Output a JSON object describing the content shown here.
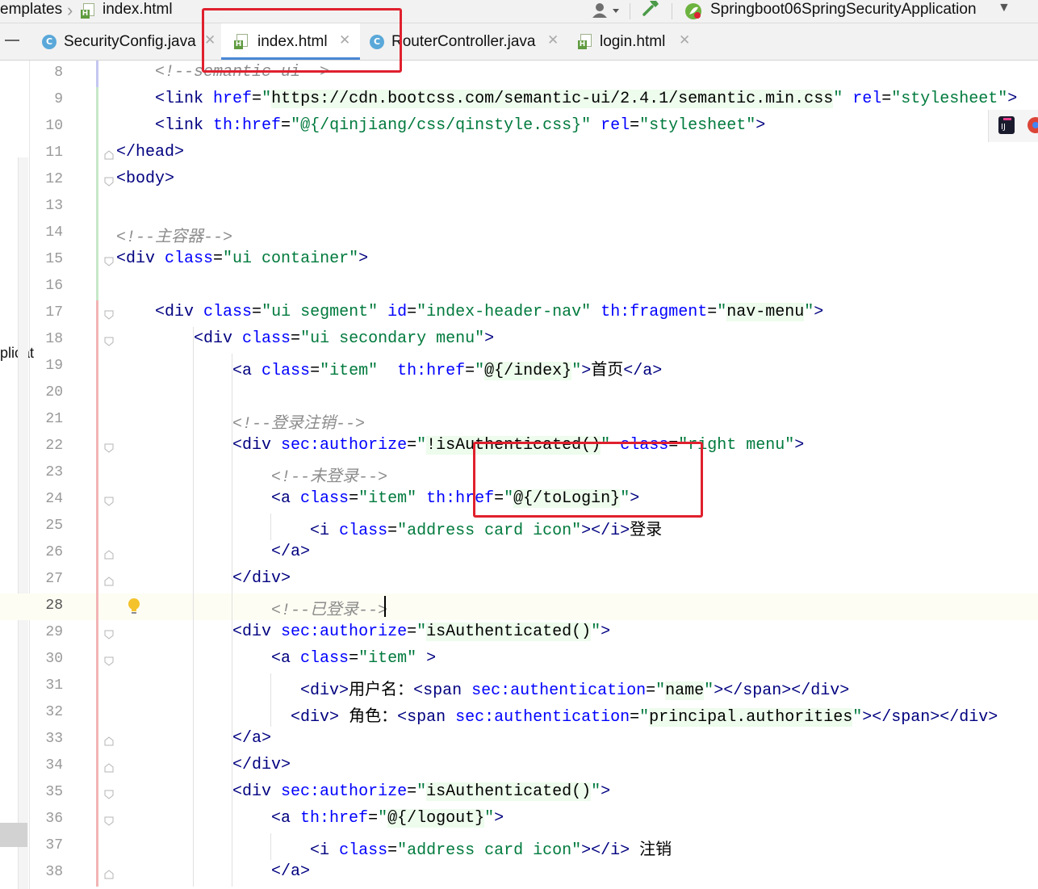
{
  "breadcrumb": {
    "folder": "emplates",
    "file": "index.html"
  },
  "run_config": {
    "name": "Springboot06SpringSecurityApplication"
  },
  "icons": [
    "user-icon",
    "hammer-icon",
    "spring-icon",
    "chevron-down-icon",
    "html-file-icon",
    "class-icon",
    "close-icon",
    "lightbulb-icon"
  ],
  "tabs": [
    {
      "label": "SecurityConfig.java",
      "type": "class",
      "active": false
    },
    {
      "label": "index.html",
      "type": "html",
      "active": true
    },
    {
      "label": "RouterController.java",
      "type": "class",
      "active": false
    },
    {
      "label": "login.html",
      "type": "html",
      "active": false
    }
  ],
  "left_strip_text": "plicat",
  "colors": {
    "tag": "#000080",
    "attribute": "#0000ff",
    "string": "#007a3d",
    "comment": "#8c8c8c",
    "active_tab_underline": "#4a88d6",
    "annotation_box": "#e0202e"
  },
  "current_line": 28,
  "lines": [
    {
      "n": 8,
      "segs": [
        {
          "t": "    "
        },
        {
          "c": "cmt",
          "t": "<!--semantic-ui-->"
        }
      ]
    },
    {
      "n": 9,
      "segs": [
        {
          "t": "    "
        },
        {
          "c": "tag",
          "t": "<link "
        },
        {
          "c": "attr",
          "t": "href"
        },
        {
          "t": "="
        },
        {
          "c": "str",
          "t": "\""
        },
        {
          "c": "hl",
          "t": "https://cdn.bootcss.com/semantic-ui/2.4.1/semantic.min.css"
        },
        {
          "c": "str",
          "t": "\""
        },
        {
          "t": " "
        },
        {
          "c": "attr",
          "t": "rel"
        },
        {
          "t": "="
        },
        {
          "c": "str",
          "t": "\"stylesheet\""
        },
        {
          "c": "tag",
          "t": ">"
        }
      ]
    },
    {
      "n": 10,
      "segs": [
        {
          "t": "    "
        },
        {
          "c": "tag",
          "t": "<link "
        },
        {
          "c": "attr",
          "t": "th:href"
        },
        {
          "t": "="
        },
        {
          "c": "str",
          "t": "\"@{/qinjiang/css/qinstyle.css}\""
        },
        {
          "t": " "
        },
        {
          "c": "attr",
          "t": "rel"
        },
        {
          "t": "="
        },
        {
          "c": "str",
          "t": "\"stylesheet\""
        },
        {
          "c": "tag",
          "t": ">"
        }
      ]
    },
    {
      "n": 11,
      "segs": [
        {
          "c": "tag",
          "t": "</head>"
        }
      ]
    },
    {
      "n": 12,
      "segs": [
        {
          "c": "tag",
          "t": "<body>"
        }
      ]
    },
    {
      "n": 13,
      "segs": []
    },
    {
      "n": 14,
      "segs": [
        {
          "c": "cmt",
          "t": "<!--主容器-->"
        }
      ]
    },
    {
      "n": 15,
      "segs": [
        {
          "c": "tag",
          "t": "<div "
        },
        {
          "c": "attr",
          "t": "class"
        },
        {
          "t": "="
        },
        {
          "c": "str",
          "t": "\"ui container\""
        },
        {
          "c": "tag",
          "t": ">"
        }
      ]
    },
    {
      "n": 16,
      "segs": []
    },
    {
      "n": 17,
      "segs": [
        {
          "t": "    "
        },
        {
          "c": "tag",
          "t": "<div "
        },
        {
          "c": "attr",
          "t": "class"
        },
        {
          "t": "="
        },
        {
          "c": "str",
          "t": "\"ui segment\""
        },
        {
          "t": " "
        },
        {
          "c": "attr",
          "t": "id"
        },
        {
          "t": "="
        },
        {
          "c": "str",
          "t": "\"index-header-nav\""
        },
        {
          "t": " "
        },
        {
          "c": "attr",
          "t": "th:fragment"
        },
        {
          "t": "="
        },
        {
          "c": "str",
          "t": "\""
        },
        {
          "c": "hl",
          "t": "nav-menu"
        },
        {
          "c": "str",
          "t": "\""
        },
        {
          "c": "tag",
          "t": ">"
        }
      ]
    },
    {
      "n": 18,
      "segs": [
        {
          "t": "        "
        },
        {
          "c": "tag",
          "t": "<div "
        },
        {
          "c": "attr",
          "t": "class"
        },
        {
          "t": "="
        },
        {
          "c": "str",
          "t": "\"ui secondary menu\""
        },
        {
          "c": "tag",
          "t": ">"
        }
      ]
    },
    {
      "n": 19,
      "segs": [
        {
          "t": "            "
        },
        {
          "c": "tag",
          "t": "<a "
        },
        {
          "c": "attr",
          "t": "class"
        },
        {
          "t": "="
        },
        {
          "c": "str",
          "t": "\"item\""
        },
        {
          "t": "  "
        },
        {
          "c": "attr",
          "t": "th:href"
        },
        {
          "t": "="
        },
        {
          "c": "str",
          "t": "\""
        },
        {
          "c": "hl",
          "t": "@{/index}"
        },
        {
          "c": "str",
          "t": "\""
        },
        {
          "c": "tag",
          "t": ">"
        },
        {
          "t": "首页"
        },
        {
          "c": "tag",
          "t": "</a>"
        }
      ]
    },
    {
      "n": 20,
      "segs": []
    },
    {
      "n": 21,
      "segs": [
        {
          "t": "            "
        },
        {
          "c": "cmt",
          "t": "<!--登录注销-->"
        }
      ]
    },
    {
      "n": 22,
      "segs": [
        {
          "t": "            "
        },
        {
          "c": "tag",
          "t": "<div "
        },
        {
          "c": "attr",
          "t": "sec:authorize"
        },
        {
          "t": "="
        },
        {
          "c": "str",
          "t": "\""
        },
        {
          "c": "hl",
          "t": "!isAuthenticated()"
        },
        {
          "c": "str",
          "t": "\""
        },
        {
          "t": " "
        },
        {
          "c": "attr",
          "t": "class"
        },
        {
          "t": "="
        },
        {
          "c": "str",
          "t": "\"right menu\""
        },
        {
          "c": "tag",
          "t": ">"
        }
      ]
    },
    {
      "n": 23,
      "segs": [
        {
          "t": "                "
        },
        {
          "c": "cmt",
          "t": "<!--未登录-->"
        }
      ]
    },
    {
      "n": 24,
      "segs": [
        {
          "t": "                "
        },
        {
          "c": "tag",
          "t": "<a "
        },
        {
          "c": "attr",
          "t": "class"
        },
        {
          "t": "="
        },
        {
          "c": "str",
          "t": "\"item\""
        },
        {
          "t": " "
        },
        {
          "c": "attr",
          "t": "th:href"
        },
        {
          "t": "="
        },
        {
          "c": "str",
          "t": "\""
        },
        {
          "c": "hl",
          "t": "@{/toLogin}"
        },
        {
          "c": "str",
          "t": "\""
        },
        {
          "c": "tag",
          "t": ">"
        }
      ]
    },
    {
      "n": 25,
      "segs": [
        {
          "t": "                    "
        },
        {
          "c": "tag",
          "t": "<i "
        },
        {
          "c": "attr",
          "t": "class"
        },
        {
          "t": "="
        },
        {
          "c": "str",
          "t": "\"address card icon\""
        },
        {
          "c": "tag",
          "t": "></i>"
        },
        {
          "t": "登录"
        }
      ]
    },
    {
      "n": 26,
      "segs": [
        {
          "t": "                "
        },
        {
          "c": "tag",
          "t": "</a>"
        }
      ]
    },
    {
      "n": 27,
      "segs": [
        {
          "t": "            "
        },
        {
          "c": "tag",
          "t": "</div>"
        }
      ]
    },
    {
      "n": 28,
      "segs": [
        {
          "t": "                "
        },
        {
          "c": "cmt",
          "t": "<!--已登录-->"
        }
      ]
    },
    {
      "n": 29,
      "segs": [
        {
          "t": "            "
        },
        {
          "c": "tag",
          "t": "<div "
        },
        {
          "c": "attr",
          "t": "sec:authorize"
        },
        {
          "t": "="
        },
        {
          "c": "str",
          "t": "\""
        },
        {
          "c": "hl",
          "t": "isAuthenticated()"
        },
        {
          "c": "str",
          "t": "\""
        },
        {
          "c": "tag",
          "t": ">"
        }
      ]
    },
    {
      "n": 30,
      "segs": [
        {
          "t": "                "
        },
        {
          "c": "tag",
          "t": "<a "
        },
        {
          "c": "attr",
          "t": "class"
        },
        {
          "t": "="
        },
        {
          "c": "str",
          "t": "\"item\""
        },
        {
          "t": " "
        },
        {
          "c": "tag",
          "t": ">"
        }
      ]
    },
    {
      "n": 31,
      "segs": [
        {
          "t": "                   "
        },
        {
          "c": "tag",
          "t": "<div>"
        },
        {
          "t": "用户名："
        },
        {
          "c": "tag",
          "t": "<span "
        },
        {
          "c": "attr",
          "t": "sec:authentication"
        },
        {
          "t": "="
        },
        {
          "c": "str",
          "t": "\""
        },
        {
          "c": "hl",
          "t": "name"
        },
        {
          "c": "str",
          "t": "\""
        },
        {
          "c": "tag",
          "t": "></span></div>"
        }
      ]
    },
    {
      "n": 32,
      "segs": [
        {
          "t": "                  "
        },
        {
          "c": "tag",
          "t": "<div>"
        },
        {
          "t": " 角色："
        },
        {
          "c": "tag",
          "t": "<span "
        },
        {
          "c": "attr",
          "t": "sec:authentication"
        },
        {
          "t": "="
        },
        {
          "c": "str",
          "t": "\""
        },
        {
          "c": "hl",
          "t": "principal.authorities"
        },
        {
          "c": "str",
          "t": "\""
        },
        {
          "c": "tag",
          "t": "></span></div>"
        }
      ]
    },
    {
      "n": 33,
      "segs": [
        {
          "t": "            "
        },
        {
          "c": "tag",
          "t": "</a>"
        }
      ]
    },
    {
      "n": 34,
      "segs": [
        {
          "t": "            "
        },
        {
          "c": "tag",
          "t": "</div>"
        }
      ]
    },
    {
      "n": 35,
      "segs": [
        {
          "t": "            "
        },
        {
          "c": "tag",
          "t": "<div "
        },
        {
          "c": "attr",
          "t": "sec:authorize"
        },
        {
          "t": "="
        },
        {
          "c": "str",
          "t": "\""
        },
        {
          "c": "hl",
          "t": "isAuthenticated()"
        },
        {
          "c": "str",
          "t": "\""
        },
        {
          "c": "tag",
          "t": ">"
        }
      ]
    },
    {
      "n": 36,
      "segs": [
        {
          "t": "                "
        },
        {
          "c": "tag",
          "t": "<a "
        },
        {
          "c": "attr",
          "t": "th:href"
        },
        {
          "t": "="
        },
        {
          "c": "str",
          "t": "\""
        },
        {
          "c": "hl",
          "t": "@{/logout}"
        },
        {
          "c": "str",
          "t": "\""
        },
        {
          "c": "tag",
          "t": ">"
        }
      ]
    },
    {
      "n": 37,
      "segs": [
        {
          "t": "                    "
        },
        {
          "c": "tag",
          "t": "<i "
        },
        {
          "c": "attr",
          "t": "class"
        },
        {
          "t": "="
        },
        {
          "c": "str",
          "t": "\"address card icon\""
        },
        {
          "c": "tag",
          "t": "></i>"
        },
        {
          "t": " 注销"
        }
      ]
    },
    {
      "n": 38,
      "segs": [
        {
          "t": "                "
        },
        {
          "c": "tag",
          "t": "</a>"
        }
      ]
    }
  ]
}
